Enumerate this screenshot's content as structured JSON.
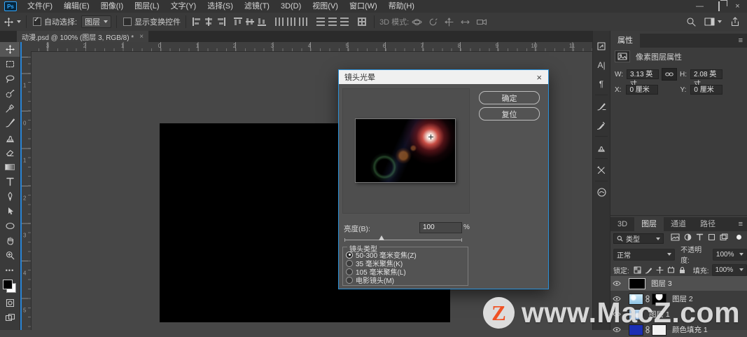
{
  "menu": {
    "items": [
      "文件(F)",
      "编辑(E)",
      "图像(I)",
      "图层(L)",
      "文字(Y)",
      "选择(S)",
      "滤镜(T)",
      "3D(D)",
      "视图(V)",
      "窗口(W)",
      "帮助(H)"
    ]
  },
  "window_controls": {
    "minimize": "—",
    "close": "×"
  },
  "options": {
    "auto_select": "自动选择:",
    "auto_select_value": "图层",
    "show_transform": "显示变换控件",
    "mode_3d": "3D 模式:"
  },
  "tab": {
    "title": "动漫.psd @ 100% (图层 3, RGB/8) *",
    "close": "×"
  },
  "rulers": {
    "h": [
      "3",
      "2",
      "1",
      "0",
      "1",
      "2",
      "3",
      "4",
      "5",
      "6",
      "7",
      "8",
      "9",
      "10",
      "11"
    ],
    "v": [
      "1",
      "0",
      "1",
      "2",
      "3",
      "4",
      "5"
    ]
  },
  "dialog": {
    "title": "镜头光晕",
    "close": "×",
    "ok": "确定",
    "reset": "复位",
    "brightness_label": "亮度(B):",
    "brightness_value": "100",
    "brightness_unit": "%",
    "lens_group_label": "镜头类型",
    "lens_options": [
      {
        "label": "50-300 毫米变焦(Z)",
        "selected": true
      },
      {
        "label": "35 毫米聚焦(K)",
        "selected": false
      },
      {
        "label": "105 毫米聚焦(L)",
        "selected": false
      },
      {
        "label": "电影镜头(M)",
        "selected": false
      }
    ]
  },
  "properties": {
    "tab": "属性",
    "header": "像素图层属性",
    "w_label": "W:",
    "w_value": "3.13 英寸",
    "h_label": "H:",
    "h_value": "2.08 英寸",
    "x_label": "X:",
    "x_value": "0 厘米",
    "y_label": "Y:",
    "y_value": "0 厘米"
  },
  "layers_panel": {
    "tabs": [
      "3D",
      "图层",
      "通道",
      "路径"
    ],
    "filter_label": "类型",
    "blend_mode": "正常",
    "opacity_label": "不透明度:",
    "opacity_value": "100%",
    "lock_label": "锁定:",
    "fill_label": "填充:",
    "fill_value": "100%",
    "layers": [
      {
        "name": "图层 3",
        "selected": true
      },
      {
        "name": "图层 2",
        "selected": false
      },
      {
        "name": "图层 1",
        "selected": false
      },
      {
        "name": "颜色填充 1",
        "selected": false
      }
    ]
  },
  "watermark": {
    "badge": "Z",
    "text": "www.MacZ.com"
  },
  "colors": {
    "accent_blue": "#2a90d8",
    "ps_logo_blue": "#31a8ff",
    "watermark_orange": "#f05123",
    "dialog_bg": "#535353",
    "canvas": "#000000"
  },
  "icons": {
    "toolbar": [
      "move-tool",
      "marquee-tool",
      "lasso-tool",
      "quick-selection-tool",
      "eyedropper-tool",
      "brush-tool",
      "clone-stamp-tool",
      "eraser-tool",
      "gradient-tool",
      "type-tool",
      "pen-tool",
      "path-selection-tool",
      "ellipse-tool",
      "hand-tool",
      "zoom-tool",
      "more-tools"
    ],
    "dock": [
      "history-panel",
      "character-panel",
      "paragraph-panel",
      "brush-settings-panel",
      "brushes-panel",
      "clone-source-panel",
      "tool-presets-panel",
      "creative-cloud"
    ]
  }
}
